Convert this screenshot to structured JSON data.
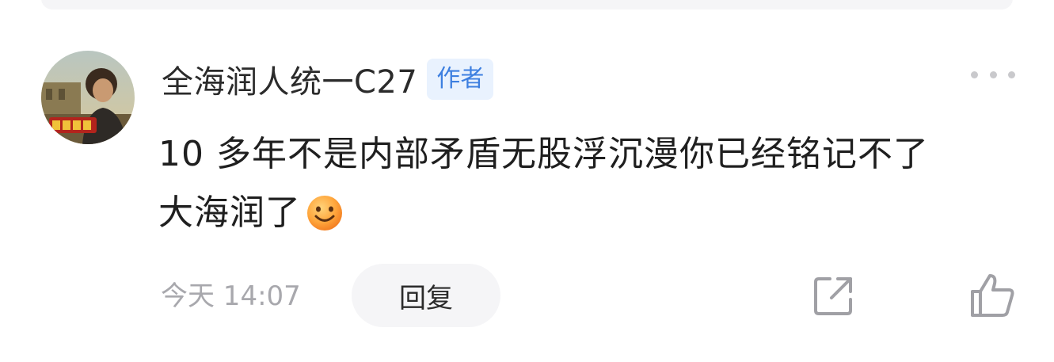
{
  "comment": {
    "author": {
      "name": "全海润人统一C27",
      "badge": "作者"
    },
    "text_line_1": "10 多年不是内部矛盾无股浮沉漫你已经铭记不了",
    "text_line_2": "大海润了",
    "emoji": "smile-emoji",
    "timestamp": "今天 14:07",
    "reply_label": "回复"
  },
  "icons": {
    "more": "more-dots-icon",
    "share": "share-icon",
    "like": "thumbs-up-icon"
  },
  "colors": {
    "badge_bg": "#e9f2fe",
    "badge_text": "#3d7fe0",
    "muted_text": "#a8a8ad",
    "pill_bg": "#f5f5f7",
    "icon_gray": "#a0a0a5"
  }
}
